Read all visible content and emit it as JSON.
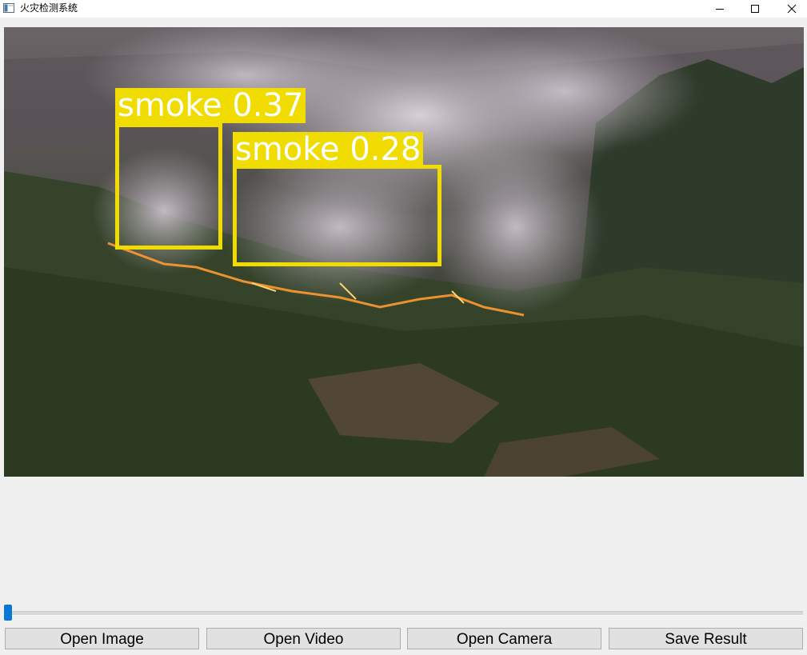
{
  "window": {
    "title": "火灾检测系统",
    "icon": "app-window-icon",
    "controls": {
      "minimize": "minimize-icon",
      "maximize": "maximize-icon",
      "close": "close-icon"
    }
  },
  "detections": [
    {
      "label": "smoke 0.37",
      "class": "smoke",
      "confidence": 0.37
    },
    {
      "label": "smoke 0.28",
      "class": "smoke",
      "confidence": 0.28
    }
  ],
  "colors": {
    "detection": "#f0dc00",
    "slider_handle": "#0a78d7"
  },
  "slider": {
    "value": 0
  },
  "buttons": {
    "open_image": "Open Image",
    "open_video": "Open Video",
    "open_camera": "Open Camera",
    "save_result": "Save Result"
  }
}
